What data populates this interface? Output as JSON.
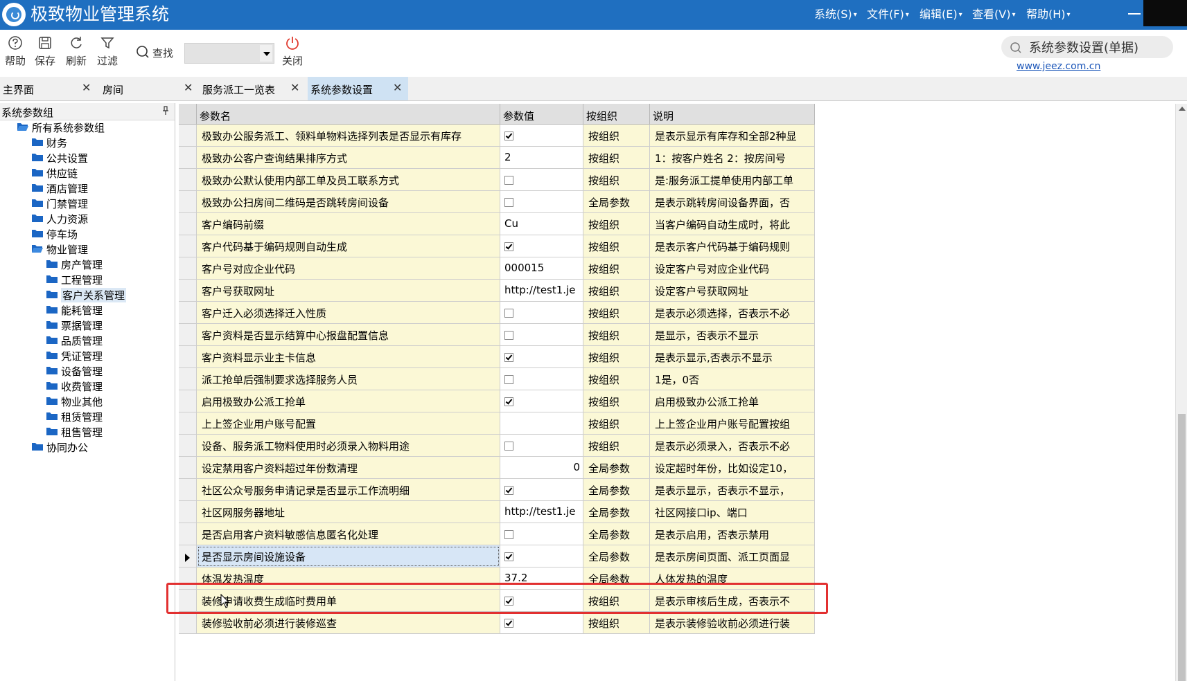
{
  "app": {
    "title": "极致物业管理系统"
  },
  "menu": [
    {
      "label": "系统(S)"
    },
    {
      "label": "文件(F)"
    },
    {
      "label": "编辑(E)"
    },
    {
      "label": "查看(V)"
    },
    {
      "label": "帮助(H)"
    }
  ],
  "toolbar": {
    "help": "帮助",
    "save": "保存",
    "refresh": "刷新",
    "filter": "过滤",
    "find": "查找",
    "find_value": "",
    "close": "关闭"
  },
  "top_search": {
    "text": "系统参数设置(单据)"
  },
  "site_link": "www.jeez.com.cn",
  "tabs": [
    {
      "label": "主界面"
    },
    {
      "label": "房间"
    },
    {
      "label": "服务派工一览表"
    },
    {
      "label": "系统参数设置"
    }
  ],
  "tree": {
    "header": "系统参数组",
    "nodes": [
      {
        "label": "所有系统参数组"
      },
      {
        "label": "财务"
      },
      {
        "label": "公共设置"
      },
      {
        "label": "供应链"
      },
      {
        "label": "酒店管理"
      },
      {
        "label": "门禁管理"
      },
      {
        "label": "人力资源"
      },
      {
        "label": "停车场"
      },
      {
        "label": "物业管理"
      },
      {
        "label": "房产管理"
      },
      {
        "label": "工程管理"
      },
      {
        "label": "客户关系管理"
      },
      {
        "label": "能耗管理"
      },
      {
        "label": "票据管理"
      },
      {
        "label": "品质管理"
      },
      {
        "label": "凭证管理"
      },
      {
        "label": "设备管理"
      },
      {
        "label": "收费管理"
      },
      {
        "label": "物业其他"
      },
      {
        "label": "租赁管理"
      },
      {
        "label": "租售管理"
      },
      {
        "label": "协同办公"
      }
    ]
  },
  "grid": {
    "columns": [
      "参数名",
      "参数值",
      "按组织",
      "说明"
    ],
    "rows": [
      {
        "name": "极致办公服务派工、领料单物料选择列表是否显示有库存",
        "value": "",
        "check": true,
        "org": "按组织",
        "desc": "是表示显示有库存和全部2种显"
      },
      {
        "name": "极致办公客户查询结果排序方式",
        "value": "2",
        "org": "按组织",
        "desc": "1：按客户姓名 2：按房间号"
      },
      {
        "name": "极致办公默认使用内部工单及员工联系方式",
        "value": "",
        "check": false,
        "org": "按组织",
        "desc": "是:服务派工提单使用内部工单"
      },
      {
        "name": "极致办公扫房间二维码是否跳转房间设备",
        "value": "",
        "check": false,
        "org": "全局参数",
        "desc": "是表示跳转房间设备界面，否"
      },
      {
        "name": "客户编码前缀",
        "value": "Cu",
        "org": "按组织",
        "desc": "当客户编码自动生成时，将此"
      },
      {
        "name": "客户代码基于编码规则自动生成",
        "value": "",
        "check": true,
        "org": "按组织",
        "desc": "是表示客户代码基于编码规则"
      },
      {
        "name": "客户号对应企业代码",
        "value": "000015",
        "org": "按组织",
        "desc": "设定客户号对应企业代码"
      },
      {
        "name": "客户号获取网址",
        "value": "http://test1.je",
        "org": "按组织",
        "desc": "设定客户号获取网址"
      },
      {
        "name": "客户迁入必须选择迁入性质",
        "value": "",
        "check": false,
        "org": "按组织",
        "desc": "是表示必须选择，否表示不必"
      },
      {
        "name": "客户资料是否显示结算中心报盘配置信息",
        "value": "",
        "check": false,
        "org": "按组织",
        "desc": "是显示，否表示不显示"
      },
      {
        "name": "客户资料显示业主卡信息",
        "value": "",
        "check": true,
        "org": "按组织",
        "desc": "是表示显示,否表示不显示"
      },
      {
        "name": "派工抢单后强制要求选择服务人员",
        "value": "",
        "check": false,
        "org": "按组织",
        "desc": "1是，0否"
      },
      {
        "name": "启用极致办公派工抢单",
        "value": "",
        "check": true,
        "org": "按组织",
        "desc": "启用极致办公派工抢单"
      },
      {
        "name": "上上签企业用户账号配置",
        "value": "",
        "org": "按组织",
        "desc": "上上签企业用户账号配置按组"
      },
      {
        "name": "设备、服务派工物料使用时必须录入物料用途",
        "value": "",
        "check": false,
        "org": "按组织",
        "desc": "是表示必须录入，否表示不必"
      },
      {
        "name": "设定禁用客户资料超过年份数清理",
        "value": "0",
        "align": "right",
        "org": "全局参数",
        "desc": "设定超时年份，比如设定10，"
      },
      {
        "name": "社区公众号服务申请记录是否显示工作流明细",
        "value": "",
        "check": true,
        "org": "全局参数",
        "desc": "是表示显示，否表示不显示，"
      },
      {
        "name": "社区网服务器地址",
        "value": "http://test1.je",
        "org": "全局参数",
        "desc": "社区网接口ip、端口"
      },
      {
        "name": "是否启用客户资料敏感信息匿名化处理",
        "value": "",
        "check": false,
        "org": "全局参数",
        "desc": "是表示启用，否表示禁用"
      },
      {
        "name": "是否显示房间设施设备",
        "value": "",
        "check": true,
        "org": "全局参数",
        "desc": "是表示房间页面、派工页面显",
        "current": true
      },
      {
        "name": "体温发热温度",
        "value": "37.2",
        "org": "全局参数",
        "desc": "人体发热的温度"
      },
      {
        "name": "装修申请收费生成临时费用单",
        "value": "",
        "check": true,
        "org": "按组织",
        "desc": "是表示审核后生成，否表示不"
      },
      {
        "name": "装修验收前必须进行装修巡查",
        "value": "",
        "check": true,
        "org": "按组织",
        "desc": "是表示装修验收前必须进行装"
      }
    ]
  },
  "colors": {
    "titlebar": "#1f6fc0",
    "cell_yellow": "#fbf8d6",
    "highlight": "#e23030",
    "active_tab": "#cfe2f3"
  }
}
